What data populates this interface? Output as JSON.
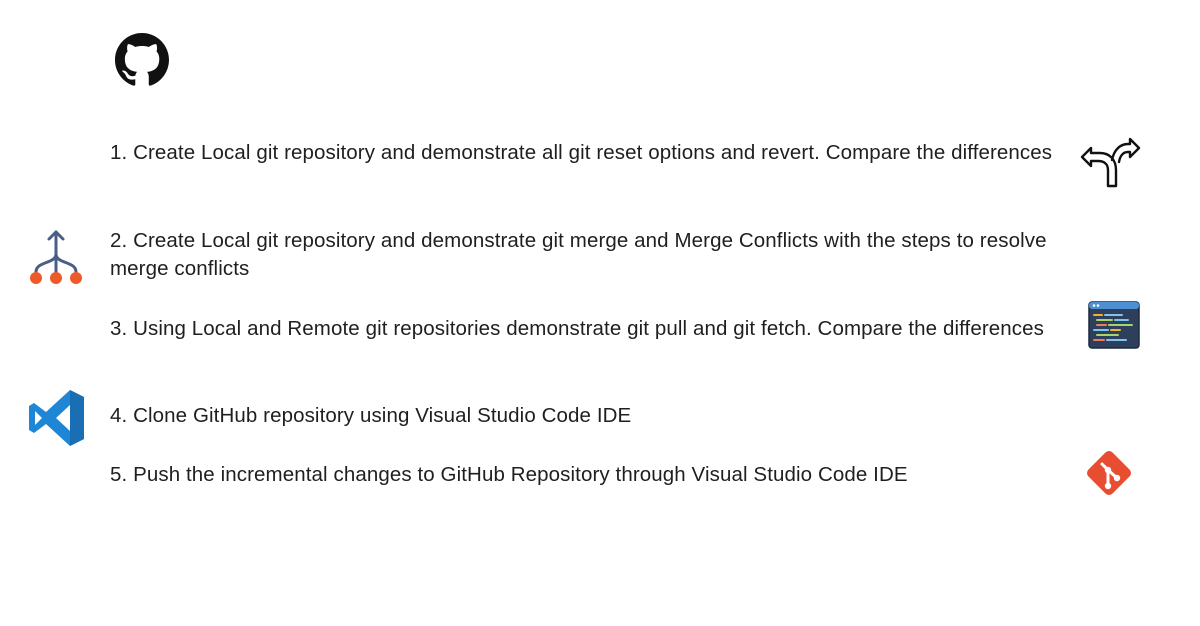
{
  "tasks": [
    {
      "text": "1. Create Local git repository and demonstrate all git reset options and revert. Compare the differences"
    },
    {
      "text": "2. Create Local git repository and demonstrate git merge and Merge Conflicts with the steps to resolve merge conflicts"
    },
    {
      "text": "3. Using Local and Remote git repositories demonstrate git pull and git fetch. Compare the differences"
    },
    {
      "text": "4. Clone GitHub repository using Visual Studio Code IDE"
    },
    {
      "text": "5. Push the incremental changes to GitHub Repository through Visual Studio Code IDE"
    }
  ],
  "icons": {
    "github": "github-logo-icon",
    "fork_arrows": "fork-arrows-icon",
    "merge": "merge-branches-icon",
    "code_window": "code-window-icon",
    "vscode": "vscode-logo-icon",
    "git": "git-logo-icon"
  },
  "colors": {
    "text": "#1f1f1f",
    "merge_blue": "#4a5f86",
    "merge_orange": "#ee5a2a",
    "vscode_blue": "#1f86d6",
    "git_red": "#e84d31"
  }
}
